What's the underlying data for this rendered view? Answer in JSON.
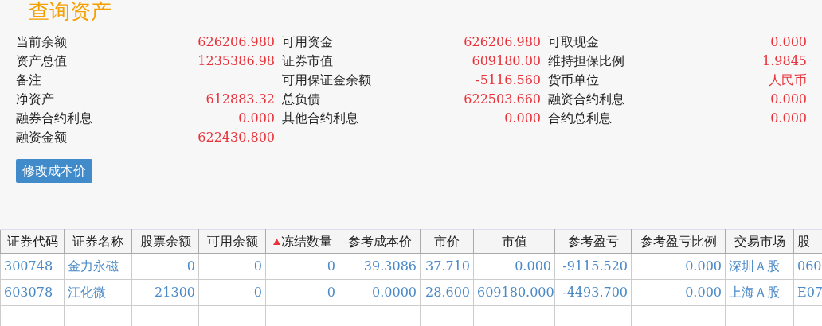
{
  "title": "查询资产",
  "summary_rows": [
    [
      {
        "label": "当前余额",
        "value": "626206.980"
      },
      {
        "label": "可用资金",
        "value": "626206.980"
      },
      {
        "label": "可取现金",
        "value": "0.000"
      }
    ],
    [
      {
        "label": "资产总值",
        "value": "1235386.98"
      },
      {
        "label": "证券市值",
        "value": "609180.00"
      },
      {
        "label": "维持担保比例",
        "value": "1.9845"
      }
    ],
    [
      {
        "label": "备注"
      },
      {
        "label": "可用保证金余额",
        "value": "-5116.560"
      },
      {
        "label": "货币单位",
        "value": "人民币"
      }
    ],
    [
      {
        "label": "净资产",
        "value": "612883.32"
      },
      {
        "label": "总负债",
        "value": "622503.660"
      },
      {
        "label": "融资合约利息",
        "value": "0.000"
      }
    ],
    [
      {
        "label": "融券合约利息",
        "value": "0.000"
      },
      {
        "label": "其他合约利息",
        "value": "0.000"
      },
      {
        "label": "合约总利息",
        "value": "0.000"
      }
    ],
    [
      {
        "label": "融资金额",
        "value": "622430.800"
      }
    ]
  ],
  "edit_button": "修改成本价",
  "table": {
    "columns": [
      {
        "label": "证券代码",
        "kind": "text",
        "sorted": false
      },
      {
        "label": "证券名称",
        "kind": "text",
        "sorted": false
      },
      {
        "label": "股票余额",
        "kind": "number",
        "sorted": false
      },
      {
        "label": "可用余额",
        "kind": "number",
        "sorted": false
      },
      {
        "label": "冻结数量",
        "kind": "number",
        "sorted": true
      },
      {
        "label": "参考成本价",
        "kind": "number",
        "sorted": false
      },
      {
        "label": "市价",
        "kind": "number",
        "sorted": false
      },
      {
        "label": "市值",
        "kind": "number",
        "sorted": false
      },
      {
        "label": "参考盈亏",
        "kind": "number",
        "sorted": false
      },
      {
        "label": "参考盈亏比例",
        "kind": "number",
        "sorted": false
      },
      {
        "label": "交易市场",
        "kind": "text",
        "sorted": false
      },
      {
        "label": "股",
        "kind": "text",
        "sorted": false
      }
    ],
    "rows": [
      [
        "300748",
        "金力永磁",
        "0",
        "0",
        "0",
        "39.3086",
        "37.710",
        "0.000",
        "-9115.520",
        "0.000",
        "深圳Ａ股",
        "060"
      ],
      [
        "603078",
        "江化微",
        "21300",
        "0",
        "0",
        "0.0000",
        "28.600",
        "609180.000",
        "-4493.700",
        "0.000",
        "上海Ａ股",
        "E07"
      ]
    ]
  }
}
